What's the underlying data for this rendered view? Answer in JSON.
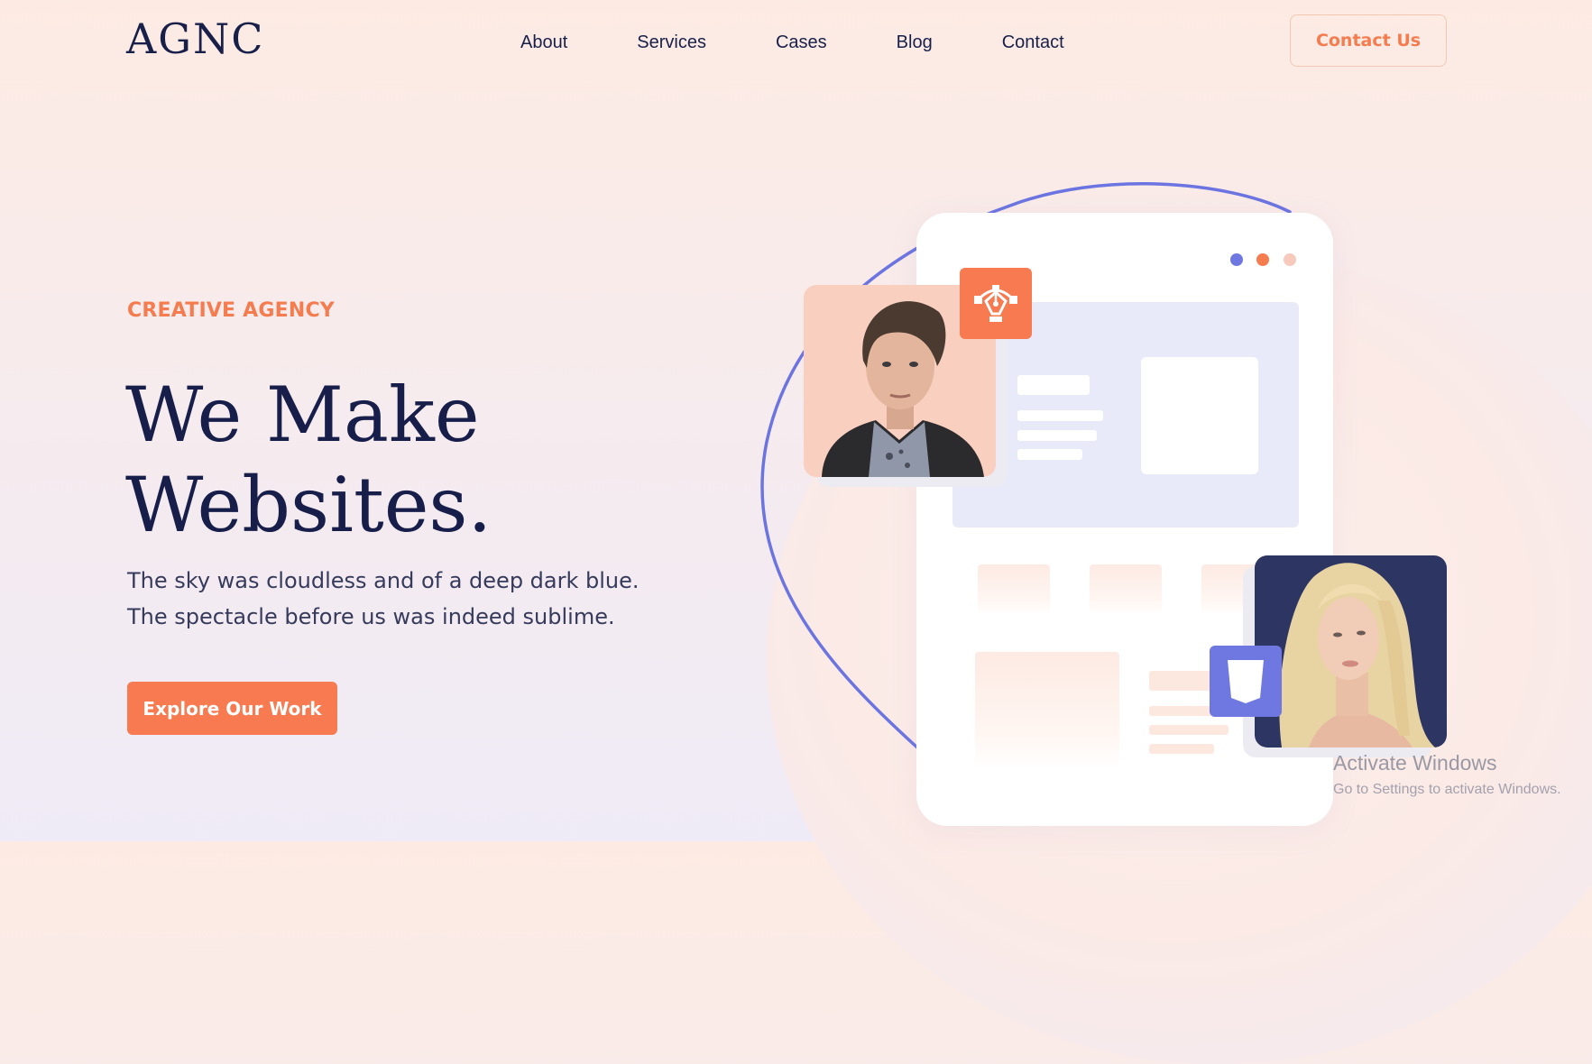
{
  "header": {
    "logo": "AGNC",
    "nav": [
      {
        "label": "About"
      },
      {
        "label": "Services"
      },
      {
        "label": "Cases"
      },
      {
        "label": "Blog"
      },
      {
        "label": "Contact"
      }
    ],
    "cta_label": "Contact Us"
  },
  "hero": {
    "eyebrow": "CREATIVE AGENCY",
    "headline_line1": "We Make",
    "headline_line2": "Websites.",
    "subtitle_line1": "The sky was cloudless and of a deep dark blue.",
    "subtitle_line2": "The spectacle before us was indeed sublime.",
    "button_label": "Explore Our Work"
  },
  "illustration": {
    "icons": [
      "pen-tool-icon",
      "css3-shield-icon"
    ],
    "window_dots_colors": [
      "#6f78e0",
      "#f47c4f",
      "#f8c9bd"
    ]
  },
  "colors": {
    "accent": "#f47c4f",
    "navy": "#18204a",
    "indigo": "#6f78e0"
  },
  "os_watermark": {
    "title": "Activate Windows",
    "subtitle": "Go to Settings to activate Windows."
  }
}
